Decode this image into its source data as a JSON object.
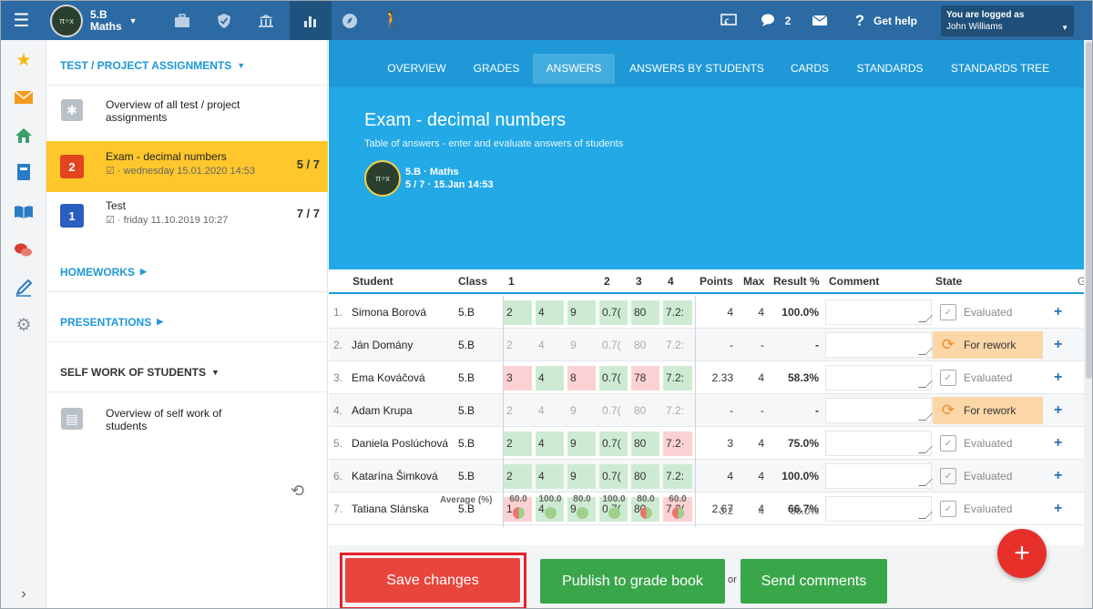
{
  "topbar": {
    "class_name": "5.B",
    "subject": "Maths",
    "messages_count": "2",
    "help_label": "Get help",
    "login_label": "You are logged as",
    "user_name": "John Williams"
  },
  "sidebar": {
    "section_tests": "TEST / PROJECT ASSIGNMENTS",
    "overview_all": "Overview of all test / project assignments",
    "items": [
      {
        "badge": "2",
        "title": "Exam - decimal numbers",
        "date": "wednesday 15.01.2020 14:53",
        "count": "5 / 7",
        "badge_color": "#e0451d"
      },
      {
        "badge": "1",
        "title": "Test",
        "date": "friday 11.10.2019 10:27",
        "count": "7 / 7",
        "badge_color": "#2a5fbf"
      }
    ],
    "section_homeworks": "HOMEWORKS",
    "section_presentations": "PRESENTATIONS",
    "section_self": "SELF WORK OF STUDENTS",
    "overview_self": "Overview of self work of students"
  },
  "tabs": [
    "OVERVIEW",
    "GRADES",
    "ANSWERS",
    "ANSWERS BY STUDENTS",
    "CARDS",
    "STANDARDS",
    "STANDARDS TREE"
  ],
  "active_tab": "ANSWERS",
  "hero": {
    "title": "Exam - decimal numbers",
    "subtitle": "Table of answers - enter and evaluate answers of students",
    "class_line": "5.B · Maths",
    "meta_line": "5 / 7 · 15.Jan 14:53"
  },
  "table": {
    "headers": {
      "student": "Student",
      "class": "Class",
      "q1": "1",
      "q2": "2",
      "q3": "3",
      "q4": "4",
      "points": "Points",
      "max": "Max",
      "result": "Result %",
      "comment": "Comment",
      "state": "State",
      "extra": "G"
    },
    "rows": [
      {
        "n": "1.",
        "name": "Simona Borová",
        "cls": "5.B",
        "a": [
          "2",
          "4",
          "9",
          "0.7(",
          "80",
          "7.2:"
        ],
        "k": [
          "g",
          "g",
          "g",
          "g",
          "g",
          "g"
        ],
        "points": "4",
        "max": "4",
        "result": "100.0%",
        "state": "Evaluated",
        "rework": false
      },
      {
        "n": "2.",
        "name": "Ján Domány",
        "cls": "5.B",
        "a": [
          "2",
          "4",
          "9",
          "0.7(",
          "80",
          "7.2:"
        ],
        "k": [
          "e",
          "e",
          "e",
          "e",
          "e",
          "e"
        ],
        "points": "-",
        "max": "-",
        "result": "-",
        "state": "For rework",
        "rework": true
      },
      {
        "n": "3.",
        "name": "Ema Kováčová",
        "cls": "5.B",
        "a": [
          "3",
          "4",
          "8",
          "0.7(",
          "78",
          "7.2:"
        ],
        "k": [
          "r",
          "g",
          "r",
          "g",
          "r",
          "g"
        ],
        "points": "2.33",
        "max": "4",
        "result": "58.3%",
        "state": "Evaluated",
        "rework": false
      },
      {
        "n": "4.",
        "name": "Adam Krupa",
        "cls": "5.B",
        "a": [
          "2",
          "4",
          "9",
          "0.7(",
          "80",
          "7.2:"
        ],
        "k": [
          "e",
          "e",
          "e",
          "e",
          "e",
          "e"
        ],
        "points": "-",
        "max": "-",
        "result": "-",
        "state": "For rework",
        "rework": true
      },
      {
        "n": "5.",
        "name": "Daniela Poslúchová",
        "cls": "5.B",
        "a": [
          "2",
          "4",
          "9",
          "0.7(",
          "80",
          "7.2·"
        ],
        "k": [
          "g",
          "g",
          "g",
          "g",
          "g",
          "r"
        ],
        "points": "3",
        "max": "4",
        "result": "75.0%",
        "state": "Evaluated",
        "rework": false
      },
      {
        "n": "6.",
        "name": "Katarína Šimková",
        "cls": "5.B",
        "a": [
          "2",
          "4",
          "9",
          "0.7(",
          "80",
          "7.2:"
        ],
        "k": [
          "g",
          "g",
          "g",
          "g",
          "g",
          "g"
        ],
        "points": "4",
        "max": "4",
        "result": "100.0%",
        "state": "Evaluated",
        "rework": false
      },
      {
        "n": "7.",
        "name": "Tatiana Slánska",
        "cls": "5.B",
        "a": [
          "1",
          "4",
          "9",
          "0.7(",
          "80",
          "7.2("
        ],
        "k": [
          "r",
          "g",
          "g",
          "g",
          "g",
          "r"
        ],
        "points": "2.67",
        "max": "4",
        "result": "66.7%",
        "state": "Evaluated",
        "rework": false
      }
    ],
    "average": {
      "label": "Average (%)",
      "values": [
        "60.0",
        "100.0",
        "80.0",
        "100.0",
        "80.0",
        "60.0"
      ],
      "half": [
        true,
        false,
        false,
        false,
        true,
        true
      ],
      "points": "3.2",
      "max": "4",
      "result": "80.0%"
    }
  },
  "footer": {
    "save": "Save changes",
    "publish": "Publish to grade book",
    "or": "or",
    "send": "Send comments"
  }
}
